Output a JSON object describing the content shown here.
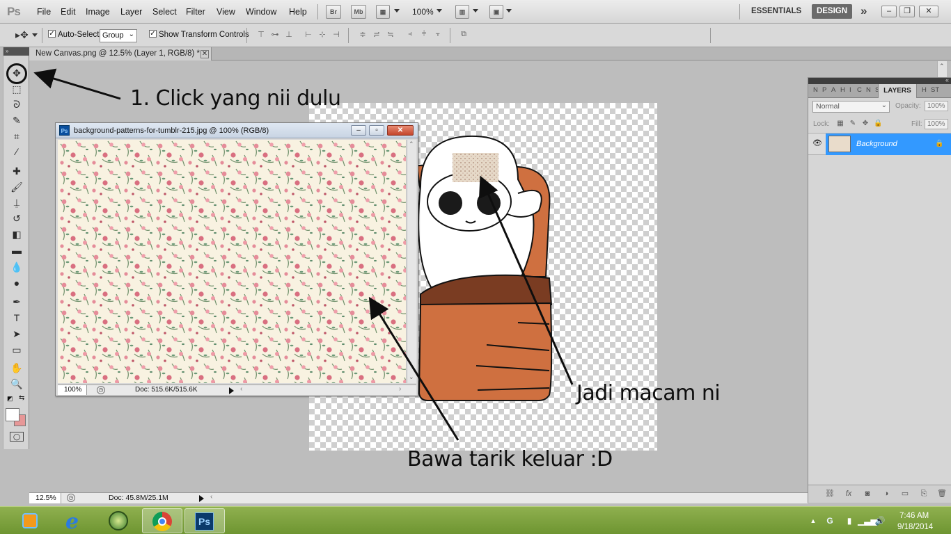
{
  "app": {
    "logo": "Ps"
  },
  "menu": [
    "File",
    "Edit",
    "Image",
    "Layer",
    "Select",
    "Filter",
    "View",
    "Window",
    "Help"
  ],
  "appbar": {
    "bridge_label": "Br",
    "minibridge_label": "Mb",
    "zoom": "100%"
  },
  "workspaces": {
    "essentials": "ESSENTIALS",
    "design": "DESIGN"
  },
  "options": {
    "auto_select_label": "Auto-Select:",
    "auto_select_checked": true,
    "auto_select_value": "Group",
    "show_transform_label": "Show Transform Controls",
    "show_transform_checked": true
  },
  "document_tab": {
    "title": "New Canvas.png @ 12.5% (Layer 1, RGB/8) *"
  },
  "floating_window": {
    "title": "background-patterns-for-tumblr-215.jpg @ 100% (RGB/8)",
    "zoom": "100%",
    "doc_size": "Doc: 515.6K/515.6K"
  },
  "statusbar": {
    "zoom": "12.5%",
    "doc_size": "Doc: 45.8M/25.1M"
  },
  "layers_panel": {
    "tabs": [
      "N",
      "P",
      "A",
      "H",
      "I",
      "C",
      "N",
      "S"
    ],
    "active_tab": "LAYERS",
    "extra_tabs": [
      "H",
      "ST"
    ],
    "blend_mode": "Normal",
    "opacity_label": "Opacity:",
    "opacity": "100%",
    "lock_label": "Lock:",
    "fill_label": "Fill:",
    "fill": "100%",
    "layers": [
      {
        "name": "Background",
        "selected": true,
        "visible": true,
        "locked": true
      }
    ]
  },
  "annotations": {
    "step1": "1. Click yang nii dulu",
    "result": "Jadi macam ni",
    "drag": "Bawa tarik keluar :D"
  },
  "taskbar": {
    "time": "7:46 AM",
    "date": "9/18/2014"
  },
  "colors": {
    "foreground_swatch": "#ffffff",
    "background_swatch": "#e69797",
    "chair": "#cf7040",
    "chair_dark": "#7a3c22",
    "selection": "#3399ff"
  }
}
